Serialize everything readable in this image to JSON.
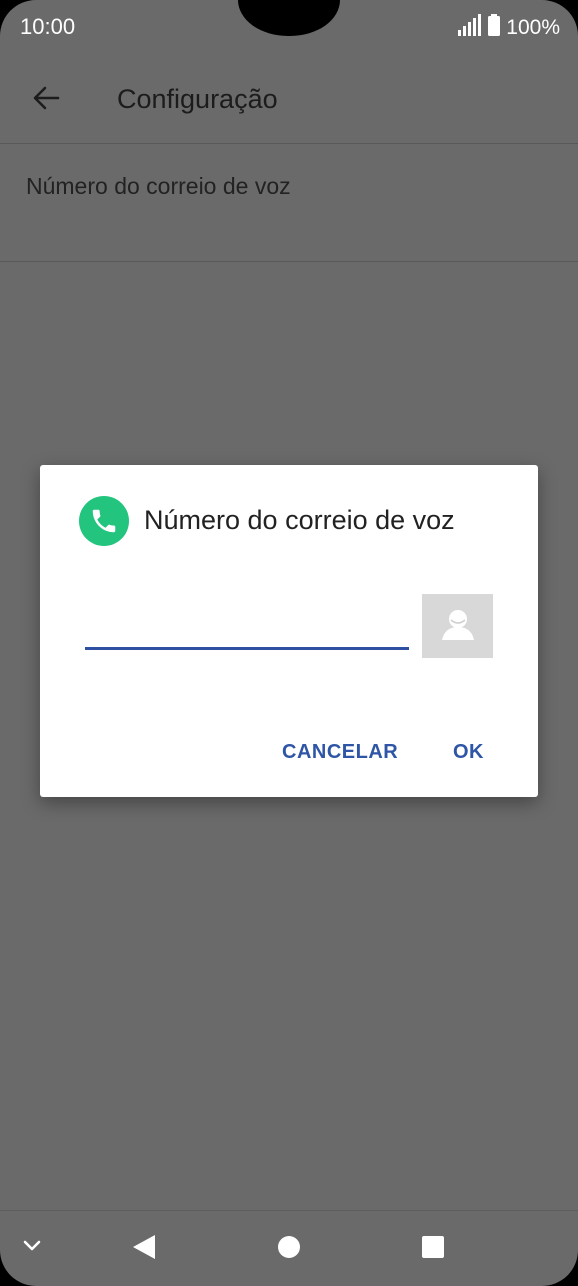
{
  "status_bar": {
    "time": "10:00",
    "battery": "100%"
  },
  "app_bar": {
    "title": "Configuração"
  },
  "list": {
    "item_label": "Número do correio de voz"
  },
  "dialog": {
    "title": "Número do correio de voz",
    "input_value": "",
    "cancel_label": "CANCELAR",
    "ok_label": "OK"
  },
  "icons": {
    "back": "arrow-left-icon",
    "phone": "phone-icon",
    "contact": "contact-picker-icon",
    "signal": "signal-icon",
    "battery": "battery-icon"
  },
  "colors": {
    "accent": "#2e55a6",
    "phone_icon_bg": "#22c47e",
    "scrim": "#6a6a6a"
  }
}
